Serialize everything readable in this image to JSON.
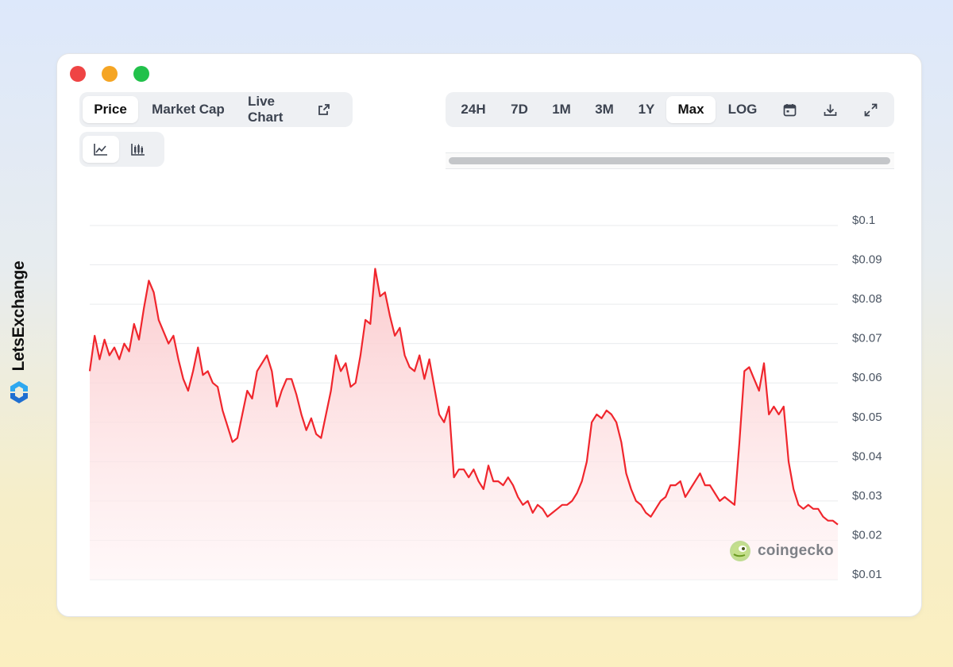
{
  "brand": {
    "name": "LetsExchange",
    "logo_icon": "letsexchange-logo-icon",
    "accent": "#2ea8f0"
  },
  "window": {
    "controls": [
      "close-dot",
      "minimize-dot",
      "maximize-dot"
    ]
  },
  "metric_tabs": [
    {
      "label": "Price",
      "active": true
    },
    {
      "label": "Market Cap",
      "active": false
    },
    {
      "label": "Live Chart",
      "icon": "external-link-icon",
      "active": false
    }
  ],
  "chart_type_tabs": [
    {
      "icon": "line-chart-icon",
      "active": true
    },
    {
      "icon": "candlestick-icon",
      "active": false
    }
  ],
  "range_tabs": [
    {
      "label": "24H",
      "active": false
    },
    {
      "label": "7D",
      "active": false
    },
    {
      "label": "1M",
      "active": false
    },
    {
      "label": "3M",
      "active": false
    },
    {
      "label": "1Y",
      "active": false
    },
    {
      "label": "Max",
      "active": true
    },
    {
      "label": "LOG",
      "active": false
    }
  ],
  "toolbar_icons": [
    "calendar-icon",
    "download-icon",
    "fullscreen-icon"
  ],
  "watermark": {
    "text": "coingecko",
    "icon": "coingecko-gecko-icon"
  },
  "colors": {
    "line": "#f0262d",
    "fill_top": "#fcd2d4",
    "fill_bottom": "#fff4f5",
    "tab_bg": "#eef0f3"
  },
  "chart_data": {
    "type": "area",
    "ylim": [
      0.01,
      0.1
    ],
    "yticks": [
      "$0.1",
      "$0.09",
      "$0.08",
      "$0.07",
      "$0.06",
      "$0.05",
      "$0.04",
      "$0.03",
      "$0.02",
      "$0.01"
    ],
    "ytick_values": [
      0.1,
      0.09,
      0.08,
      0.07,
      0.06,
      0.05,
      0.04,
      0.03,
      0.02,
      0.01
    ],
    "grid": true,
    "y_axis_position": "right",
    "series": [
      {
        "values": [
          0.063,
          0.072,
          0.066,
          0.071,
          0.067,
          0.069,
          0.066,
          0.07,
          0.068,
          0.075,
          0.071,
          0.079,
          0.086,
          0.083,
          0.076,
          0.073,
          0.07,
          0.072,
          0.066,
          0.061,
          0.058,
          0.063,
          0.069,
          0.062,
          0.063,
          0.06,
          0.059,
          0.053,
          0.049,
          0.045,
          0.046,
          0.052,
          0.058,
          0.056,
          0.063,
          0.065,
          0.067,
          0.063,
          0.054,
          0.058,
          0.061,
          0.061,
          0.057,
          0.052,
          0.048,
          0.051,
          0.047,
          0.046,
          0.052,
          0.058,
          0.067,
          0.063,
          0.065,
          0.059,
          0.06,
          0.067,
          0.076,
          0.075,
          0.089,
          0.082,
          0.083,
          0.077,
          0.072,
          0.074,
          0.067,
          0.064,
          0.063,
          0.067,
          0.061,
          0.066,
          0.059,
          0.052,
          0.05,
          0.054,
          0.036,
          0.038,
          0.038,
          0.036,
          0.038,
          0.035,
          0.033,
          0.039,
          0.035,
          0.035,
          0.034,
          0.036,
          0.034,
          0.031,
          0.029,
          0.03,
          0.027,
          0.029,
          0.028,
          0.026,
          0.027,
          0.028,
          0.029,
          0.029,
          0.03,
          0.032,
          0.035,
          0.04,
          0.05,
          0.052,
          0.051,
          0.053,
          0.052,
          0.05,
          0.045,
          0.037,
          0.033,
          0.03,
          0.029,
          0.027,
          0.026,
          0.028,
          0.03,
          0.031,
          0.034,
          0.034,
          0.035,
          0.031,
          0.033,
          0.035,
          0.037,
          0.034,
          0.034,
          0.032,
          0.03,
          0.031,
          0.03,
          0.029,
          0.045,
          0.063,
          0.064,
          0.061,
          0.058,
          0.065,
          0.052,
          0.054,
          0.052,
          0.054,
          0.04,
          0.033,
          0.029,
          0.028,
          0.029,
          0.028,
          0.028,
          0.026,
          0.025,
          0.025,
          0.024
        ]
      }
    ]
  }
}
